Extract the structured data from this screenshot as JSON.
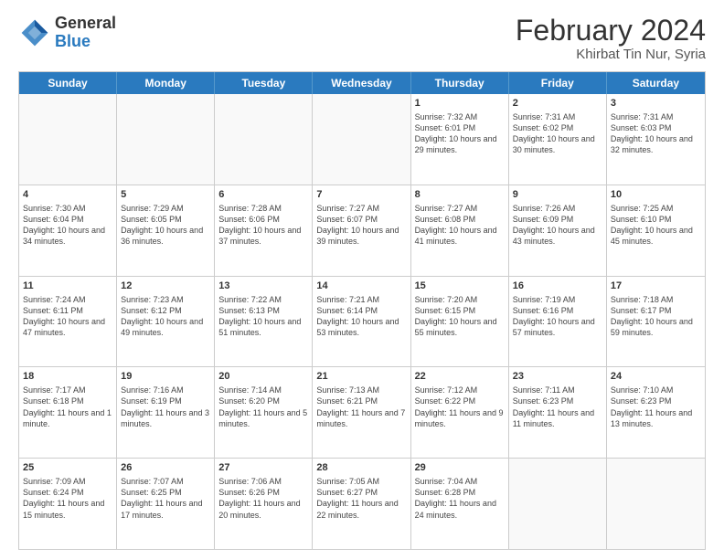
{
  "logo": {
    "general": "General",
    "blue": "Blue"
  },
  "title": "February 2024",
  "subtitle": "Khirbat Tin Nur, Syria",
  "days": [
    "Sunday",
    "Monday",
    "Tuesday",
    "Wednesday",
    "Thursday",
    "Friday",
    "Saturday"
  ],
  "weeks": [
    [
      {
        "num": "",
        "info": ""
      },
      {
        "num": "",
        "info": ""
      },
      {
        "num": "",
        "info": ""
      },
      {
        "num": "",
        "info": ""
      },
      {
        "num": "1",
        "info": "Sunrise: 7:32 AM\nSunset: 6:01 PM\nDaylight: 10 hours and 29 minutes."
      },
      {
        "num": "2",
        "info": "Sunrise: 7:31 AM\nSunset: 6:02 PM\nDaylight: 10 hours and 30 minutes."
      },
      {
        "num": "3",
        "info": "Sunrise: 7:31 AM\nSunset: 6:03 PM\nDaylight: 10 hours and 32 minutes."
      }
    ],
    [
      {
        "num": "4",
        "info": "Sunrise: 7:30 AM\nSunset: 6:04 PM\nDaylight: 10 hours and 34 minutes."
      },
      {
        "num": "5",
        "info": "Sunrise: 7:29 AM\nSunset: 6:05 PM\nDaylight: 10 hours and 36 minutes."
      },
      {
        "num": "6",
        "info": "Sunrise: 7:28 AM\nSunset: 6:06 PM\nDaylight: 10 hours and 37 minutes."
      },
      {
        "num": "7",
        "info": "Sunrise: 7:27 AM\nSunset: 6:07 PM\nDaylight: 10 hours and 39 minutes."
      },
      {
        "num": "8",
        "info": "Sunrise: 7:27 AM\nSunset: 6:08 PM\nDaylight: 10 hours and 41 minutes."
      },
      {
        "num": "9",
        "info": "Sunrise: 7:26 AM\nSunset: 6:09 PM\nDaylight: 10 hours and 43 minutes."
      },
      {
        "num": "10",
        "info": "Sunrise: 7:25 AM\nSunset: 6:10 PM\nDaylight: 10 hours and 45 minutes."
      }
    ],
    [
      {
        "num": "11",
        "info": "Sunrise: 7:24 AM\nSunset: 6:11 PM\nDaylight: 10 hours and 47 minutes."
      },
      {
        "num": "12",
        "info": "Sunrise: 7:23 AM\nSunset: 6:12 PM\nDaylight: 10 hours and 49 minutes."
      },
      {
        "num": "13",
        "info": "Sunrise: 7:22 AM\nSunset: 6:13 PM\nDaylight: 10 hours and 51 minutes."
      },
      {
        "num": "14",
        "info": "Sunrise: 7:21 AM\nSunset: 6:14 PM\nDaylight: 10 hours and 53 minutes."
      },
      {
        "num": "15",
        "info": "Sunrise: 7:20 AM\nSunset: 6:15 PM\nDaylight: 10 hours and 55 minutes."
      },
      {
        "num": "16",
        "info": "Sunrise: 7:19 AM\nSunset: 6:16 PM\nDaylight: 10 hours and 57 minutes."
      },
      {
        "num": "17",
        "info": "Sunrise: 7:18 AM\nSunset: 6:17 PM\nDaylight: 10 hours and 59 minutes."
      }
    ],
    [
      {
        "num": "18",
        "info": "Sunrise: 7:17 AM\nSunset: 6:18 PM\nDaylight: 11 hours and 1 minute."
      },
      {
        "num": "19",
        "info": "Sunrise: 7:16 AM\nSunset: 6:19 PM\nDaylight: 11 hours and 3 minutes."
      },
      {
        "num": "20",
        "info": "Sunrise: 7:14 AM\nSunset: 6:20 PM\nDaylight: 11 hours and 5 minutes."
      },
      {
        "num": "21",
        "info": "Sunrise: 7:13 AM\nSunset: 6:21 PM\nDaylight: 11 hours and 7 minutes."
      },
      {
        "num": "22",
        "info": "Sunrise: 7:12 AM\nSunset: 6:22 PM\nDaylight: 11 hours and 9 minutes."
      },
      {
        "num": "23",
        "info": "Sunrise: 7:11 AM\nSunset: 6:23 PM\nDaylight: 11 hours and 11 minutes."
      },
      {
        "num": "24",
        "info": "Sunrise: 7:10 AM\nSunset: 6:23 PM\nDaylight: 11 hours and 13 minutes."
      }
    ],
    [
      {
        "num": "25",
        "info": "Sunrise: 7:09 AM\nSunset: 6:24 PM\nDaylight: 11 hours and 15 minutes."
      },
      {
        "num": "26",
        "info": "Sunrise: 7:07 AM\nSunset: 6:25 PM\nDaylight: 11 hours and 17 minutes."
      },
      {
        "num": "27",
        "info": "Sunrise: 7:06 AM\nSunset: 6:26 PM\nDaylight: 11 hours and 20 minutes."
      },
      {
        "num": "28",
        "info": "Sunrise: 7:05 AM\nSunset: 6:27 PM\nDaylight: 11 hours and 22 minutes."
      },
      {
        "num": "29",
        "info": "Sunrise: 7:04 AM\nSunset: 6:28 PM\nDaylight: 11 hours and 24 minutes."
      },
      {
        "num": "",
        "info": ""
      },
      {
        "num": "",
        "info": ""
      }
    ]
  ]
}
